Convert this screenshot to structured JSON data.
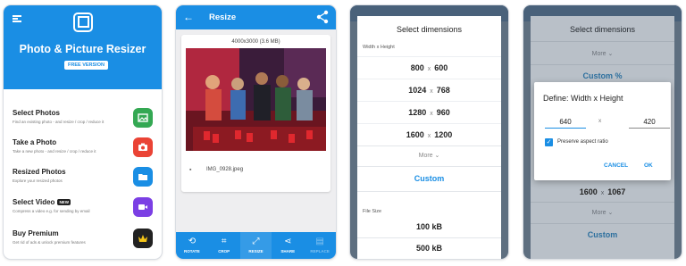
{
  "panel1": {
    "app_title": "Photo & Picture Resizer",
    "badge": "FREE VERSION",
    "features": [
      {
        "title": "Select Photos",
        "desc": "Find an existing photo - and resize / crop / reduce it",
        "icon": "image-icon",
        "color": "#34a853"
      },
      {
        "title": "Take a Photo",
        "desc": "Take a new photo - and resize / crop / reduce it",
        "icon": "camera-icon",
        "color": "#ea4335"
      },
      {
        "title": "Resized Photos",
        "desc": "Explore your resized photos",
        "icon": "folder-icon",
        "color": "#1a8ee4"
      },
      {
        "title": "Select Video",
        "badge": "NEW",
        "desc": "Compress a video e.g. for sending by email",
        "icon": "video-icon",
        "color": "#7b3fe4"
      },
      {
        "title": "Buy Premium",
        "desc": "Get rid of ads & unlock premium features",
        "icon": "crown-icon",
        "color": "#222222"
      }
    ]
  },
  "panel2": {
    "title": "Resize",
    "image_info": "4000x3000 (3.6 MB)",
    "filename": "IMG_0928.jpeg",
    "nav": [
      {
        "label": "ROTATE",
        "icon": "rotate-icon"
      },
      {
        "label": "CROP",
        "icon": "crop-icon"
      },
      {
        "label": "RESIZE",
        "icon": "resize-icon"
      },
      {
        "label": "SHARE",
        "icon": "share-icon"
      },
      {
        "label": "REPLACE",
        "icon": "replace-icon"
      }
    ]
  },
  "panel3": {
    "title": "Select dimensions",
    "section_label": "Width x Height",
    "dims": [
      {
        "w": "800",
        "h": "600"
      },
      {
        "w": "1024",
        "h": "768"
      },
      {
        "w": "1280",
        "h": "960"
      },
      {
        "w": "1600",
        "h": "1200"
      }
    ],
    "x": "x",
    "more": "More ⌄",
    "custom": "Custom",
    "file_size_label": "File Size",
    "sizes": [
      "100 kB",
      "500 kB"
    ]
  },
  "panel4": {
    "title": "Select dimensions",
    "more": "More ⌄",
    "custom_pct": "Custom %",
    "bottom_dim": {
      "w": "1600",
      "h": "1067"
    },
    "x": "x",
    "more2": "More ⌄",
    "custom": "Custom",
    "dialog": {
      "title": "Define: Width x Height",
      "width": "640",
      "height": "420",
      "x": "x",
      "checkbox_label": "Preserve aspect ratio",
      "cancel": "CANCEL",
      "ok": "OK"
    }
  }
}
